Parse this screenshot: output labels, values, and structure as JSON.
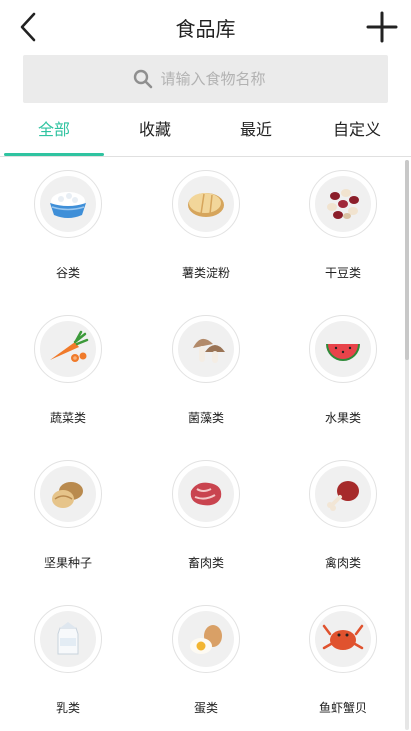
{
  "header": {
    "title": "食品库",
    "back_icon": "chevron-left-icon",
    "add_icon": "plus-icon"
  },
  "search": {
    "placeholder": "请输入食物名称",
    "value": "",
    "icon": "search-icon"
  },
  "tabs": [
    {
      "label": "全部",
      "active": true
    },
    {
      "label": "收藏",
      "active": false
    },
    {
      "label": "最近",
      "active": false
    },
    {
      "label": "自定义",
      "active": false
    }
  ],
  "categories": [
    {
      "label": "谷类",
      "icon": "grain-bowl-icon"
    },
    {
      "label": "薯类淀粉",
      "icon": "potato-icon"
    },
    {
      "label": "干豆类",
      "icon": "beans-icon"
    },
    {
      "label": "蔬菜类",
      "icon": "carrot-icon"
    },
    {
      "label": "菌藻类",
      "icon": "mushroom-icon"
    },
    {
      "label": "水果类",
      "icon": "watermelon-icon"
    },
    {
      "label": "坚果种子",
      "icon": "nuts-icon"
    },
    {
      "label": "畜肉类",
      "icon": "red-meat-icon"
    },
    {
      "label": "禽肉类",
      "icon": "drumstick-icon"
    },
    {
      "label": "乳类",
      "icon": "milk-carton-icon"
    },
    {
      "label": "蛋类",
      "icon": "eggs-icon"
    },
    {
      "label": "鱼虾蟹贝",
      "icon": "seafood-icon"
    }
  ],
  "colors": {
    "accent": "#2fc3a0",
    "search_bg": "#ebebeb",
    "placeholder": "#b2b2b2"
  }
}
